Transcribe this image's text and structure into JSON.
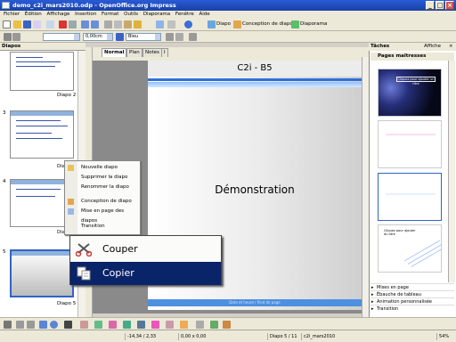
{
  "window": {
    "title": "demo_c2i_mars2010.odp - OpenOffice.org Impress",
    "buttons": [
      "_",
      "□",
      "×"
    ]
  },
  "menu": [
    "Fichier",
    "Édition",
    "Affichage",
    "Insertion",
    "Format",
    "Outils",
    "Diaporama",
    "Fenêtre",
    "Aide"
  ],
  "toolbar1": {
    "diapo_label": "Diapo",
    "conception_label": "Conception de diapo",
    "diaporama_label": "Diaporama"
  },
  "toolbar2": {
    "line_width": "0,00cm",
    "color": "Bleu"
  },
  "slides_pane": {
    "header": "Diapos",
    "slides": [
      {
        "num": "",
        "label": "Diapo 2"
      },
      {
        "num": "3",
        "label": "Diapo 3"
      },
      {
        "num": "4",
        "label": "Diapo 4"
      },
      {
        "num": "5",
        "label": "Diapo 5"
      }
    ]
  },
  "view_tabs": [
    "Normal",
    "Plan",
    "Notes",
    "I"
  ],
  "slide": {
    "title": "C2i - B5",
    "body": "Démonstration",
    "footer": "Date et heure / Pied de page"
  },
  "context_menu": {
    "items": [
      {
        "label": "Nouvelle diapo",
        "disabled": false
      },
      {
        "label": "Supprimer la diapo",
        "disabled": false
      },
      {
        "label": "Renommer la diapo",
        "disabled": false
      },
      {
        "label": "Conception de diapo",
        "disabled": false
      },
      {
        "label": "Mise en page des diapos",
        "disabled": false
      },
      {
        "label": "Transition",
        "disabled": false
      }
    ]
  },
  "big_menu": {
    "items": [
      {
        "label": "Couper",
        "highlighted": false
      },
      {
        "label": "Copier",
        "highlighted": true
      }
    ]
  },
  "tasks_pane": {
    "header": "Tâches",
    "view_label": "Affiche",
    "section": "Pages maîtresses",
    "master1_text": "Cliquez pour ajouter un titre",
    "master4_text": "Cliquez pour ajouter du titre",
    "expanders": [
      "Mises en page",
      "Ébauche de tableau",
      "Animation personnalisée",
      "Transition"
    ]
  },
  "status": {
    "position": "-14,34 / 2,33",
    "size": "0,00 x 0,00",
    "slide": "Diapo 5 / 11",
    "master": "c2i_mars2010",
    "zoom": "54%"
  },
  "colors": {
    "titlebar": "#1941a5",
    "highlight": "#0a246a",
    "slide_accent": "#2f6fd9"
  }
}
